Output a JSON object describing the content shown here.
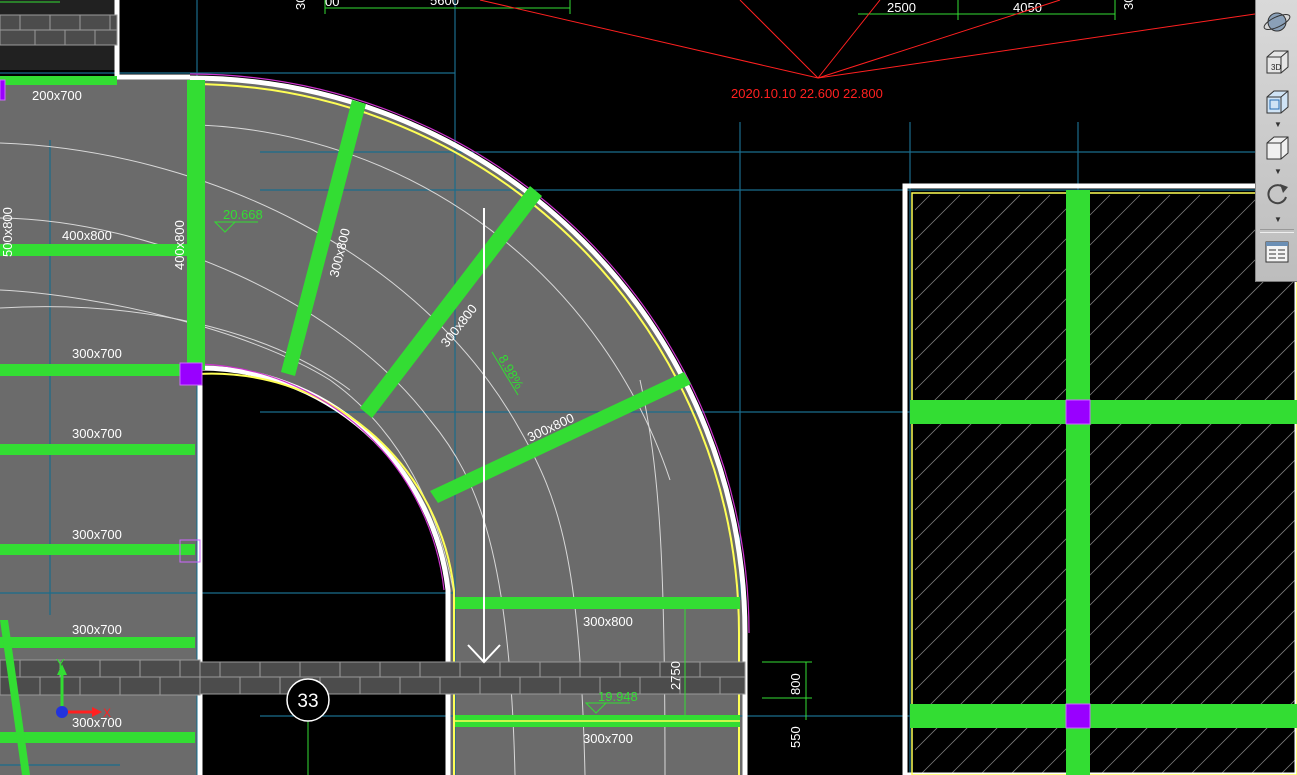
{
  "drawing": {
    "top_dims": [
      "30",
      "00",
      "5600",
      "2500",
      "4050",
      "30"
    ],
    "revision_note": "2020.10.10 ",
    "revision_levels": "22.600 22.800",
    "beams": {
      "b200x700": "200x700",
      "b400x800": "400x800",
      "b300x700_a": "300x700",
      "b300x700_b": "300x700",
      "b300x700_c": "300x700",
      "b300x700_d": "300x700",
      "b300x700_e": "300x700",
      "b300x700_f": "300x700",
      "b500x800": "500x800",
      "b400x800v": "400x800",
      "b300x800_a": "300x800",
      "b300x800_b": "300x800",
      "b300x800_c": "300x800",
      "b300x800_d": "300x800"
    },
    "elevation_1": "20.668",
    "elevation_2": "19.948",
    "slope": "8.98%",
    "dim_2750": "2750",
    "dim_800": "800",
    "dim_550": "550",
    "grid_bubble": "33",
    "ucs_x": "X",
    "ucs_y": "Y"
  },
  "toolbar": {
    "buttons": [
      "orbit-icon",
      "view-3d-icon",
      "view-cube-icon",
      "view-box-icon",
      "rotate-icon",
      "properties-panel-icon"
    ],
    "view_3d_label": "3D"
  },
  "colors": {
    "background": "#000000",
    "slab": "#6b6b6b",
    "beam": "#33dd33",
    "wall": "#ffffff",
    "column": "#9900ff",
    "gridline": "#1a6c8c",
    "annotation": "#ff2020"
  }
}
